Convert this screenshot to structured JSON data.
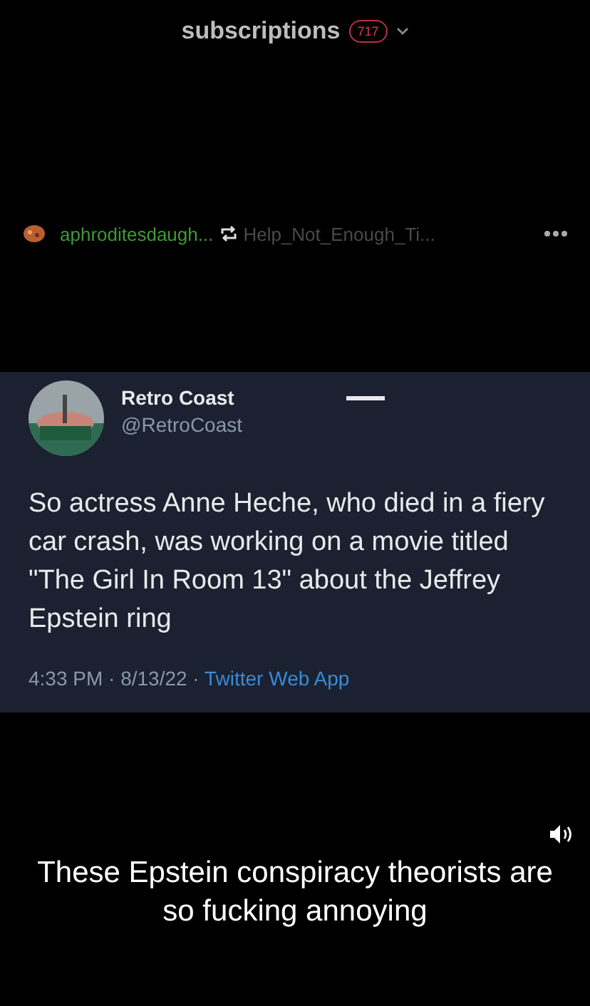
{
  "header": {
    "title": "subscriptions",
    "badge": "717"
  },
  "post": {
    "blog": "aphroditesdaugh...",
    "reblogged_from": "Help_Not_Enough_Ti..."
  },
  "tweet": {
    "name": "Retro Coast",
    "handle": "@RetroCoast",
    "text": "So actress Anne Heche, who died in a fiery car crash, was working on a movie titled \"The Girl In Room 13\" about the Jeffrey Epstein ring",
    "timestamp": "4:33 PM · 8/13/22 · ",
    "source": "Twitter Web App"
  },
  "caption": "These Epstein conspiracy theorists are so fucking annoying"
}
